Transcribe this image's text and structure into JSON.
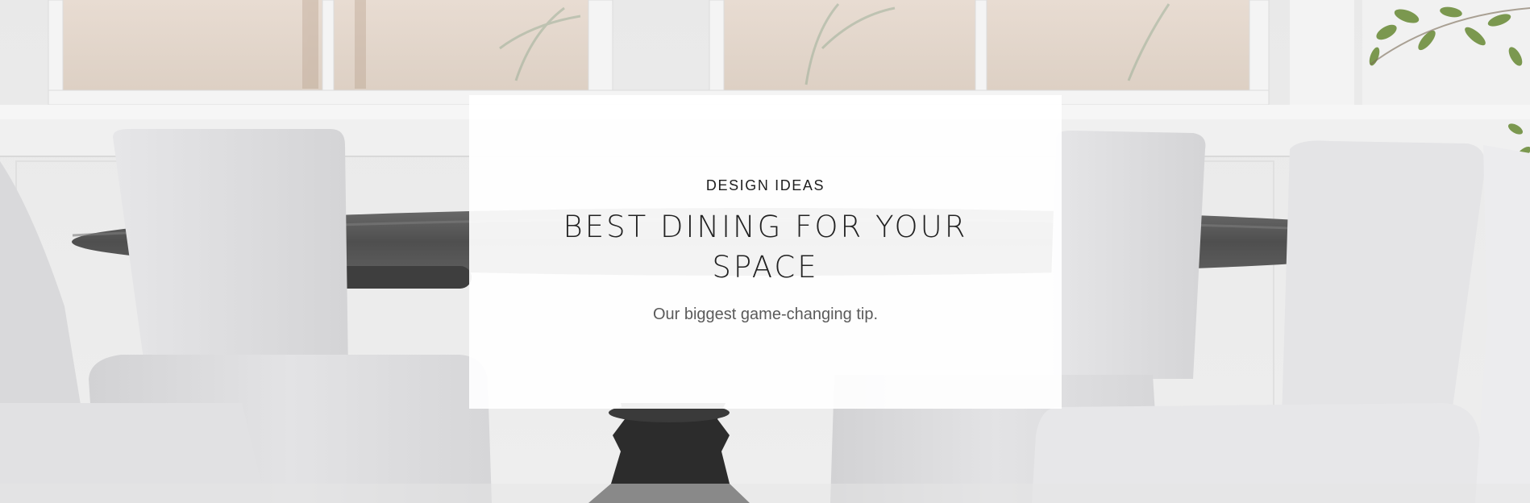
{
  "hero": {
    "eyebrow": "DESIGN IDEAS",
    "headline": "BEST DINING FOR YOUR SPACE",
    "subtitle": "Our biggest game-changing tip.",
    "image_description_icon": "dining-room-photo"
  },
  "colors": {
    "card_background": "#ffffff",
    "text_dark": "#222222",
    "text_muted": "#5a5a5a",
    "table_top": "#575757",
    "pedestal": "#2e2e2e",
    "chair_fabric": "#dcdcde"
  }
}
